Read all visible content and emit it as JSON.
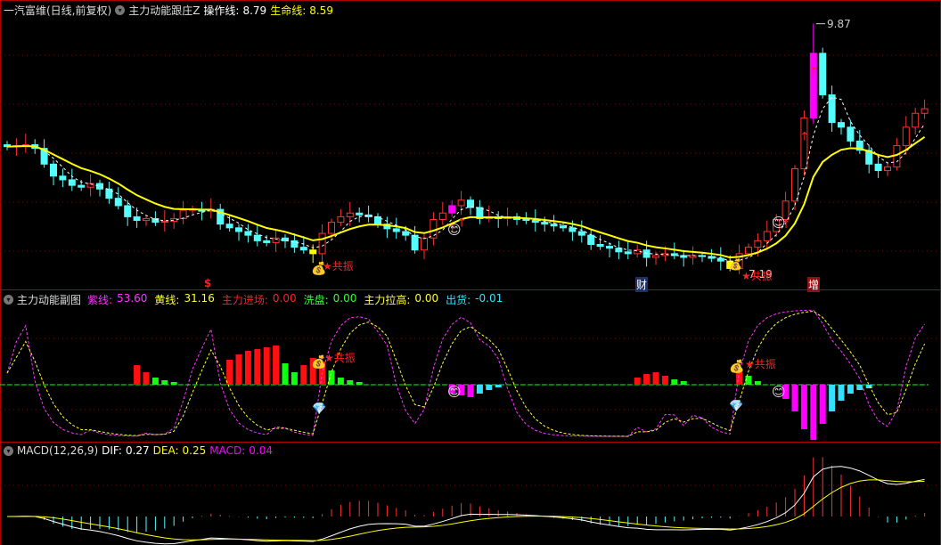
{
  "main_header": {
    "stock": "一汽富维(日线,前复权)",
    "indicator": "主力动能跟庄Z",
    "op_line_label": "操作线:",
    "op_line_value": "8.79",
    "life_line_label": "生命线:",
    "life_line_value": "8.59"
  },
  "sub_header": {
    "indicator": "主力动能副图",
    "items": [
      {
        "label": "紫线:",
        "value": "53.60",
        "color": "#ff33ff"
      },
      {
        "label": "黄线:",
        "value": "31.16",
        "color": "#ffff33"
      },
      {
        "label": "主力进场:",
        "value": "0.00",
        "color": "#ff2020"
      },
      {
        "label": "洗盘:",
        "value": "0.00",
        "color": "#33ff33"
      },
      {
        "label": "主力拉高:",
        "value": "0.00",
        "color": "#ffff33"
      },
      {
        "label": "出货:",
        "value": "-0.01",
        "color": "#33e0ff"
      }
    ]
  },
  "macd_header": {
    "indicator": "MACD(12,26,9)",
    "dif_label": "DIF:",
    "dif_value": "0.27",
    "dea_label": "DEA:",
    "dea_value": "0.25",
    "macd_label": "MACD:",
    "macd_value": "0.04"
  },
  "annotations": {
    "high_price": "9.87",
    "low_price": "7.19",
    "resonance": "共振",
    "dollar": "$",
    "cai": "财",
    "zeng": "增"
  },
  "colors": {
    "up": "#ff3030",
    "down": "#54fcfc",
    "life_line": "#ffff00",
    "op_line": "#ffffff",
    "grid": "#800000"
  },
  "chart_data": {
    "type": "candlestick",
    "title": "一汽富维(日线,前复权)",
    "ylim": [
      7.0,
      10.05
    ],
    "high_mark": 9.87,
    "low_mark": 7.19,
    "closes": [
      8.54,
      8.55,
      8.56,
      8.52,
      8.35,
      8.22,
      8.18,
      8.12,
      8.1,
      8.14,
      8.08,
      7.98,
      7.9,
      7.78,
      7.74,
      7.76,
      7.72,
      7.73,
      7.76,
      7.85,
      7.86,
      7.84,
      7.86,
      7.7,
      7.66,
      7.62,
      7.58,
      7.52,
      7.5,
      7.55,
      7.52,
      7.45,
      7.42,
      7.38,
      7.6,
      7.72,
      7.78,
      7.82,
      7.8,
      7.78,
      7.7,
      7.65,
      7.62,
      7.58,
      7.42,
      7.55,
      7.75,
      7.82,
      7.9,
      7.96,
      7.88,
      7.76,
      7.78,
      7.76,
      7.78,
      7.75,
      7.74,
      7.72,
      7.7,
      7.68,
      7.66,
      7.62,
      7.58,
      7.48,
      7.46,
      7.44,
      7.4,
      7.38,
      7.42,
      7.34,
      7.36,
      7.38,
      7.36,
      7.34,
      7.36,
      7.35,
      7.33,
      7.3,
      7.22,
      7.38,
      7.45,
      7.52,
      7.62,
      7.75,
      7.95,
      8.3,
      8.85,
      9.55,
      9.1,
      8.8,
      8.75,
      8.6,
      8.5,
      8.35,
      8.28,
      8.32,
      8.55,
      8.75,
      8.9,
      8.95
    ],
    "special_bars": {
      "magenta": [
        48,
        87
      ],
      "yellow": [
        33,
        78
      ]
    },
    "sub_histogram": {
      "red": {
        "14": 22,
        "15": 14,
        "24": 28,
        "25": 34,
        "26": 38,
        "27": 40,
        "28": 42,
        "29": 44,
        "32": 22,
        "33": 30,
        "34": 26,
        "68": 8,
        "69": 12,
        "70": 14,
        "71": 10,
        "79": 14
      },
      "green": {
        "16": 8,
        "17": 5,
        "18": 3,
        "30": 24,
        "31": 14,
        "35": 16,
        "36": 8,
        "37": 5,
        "38": 3,
        "72": 6,
        "73": 4,
        "80": 10,
        "81": 4
      },
      "magenta": {
        "48": -10,
        "49": -12,
        "50": -14,
        "84": -16,
        "85": -30,
        "86": -50,
        "87": -62,
        "88": -44
      },
      "cyan": {
        "51": -10,
        "52": -6,
        "53": -3,
        "89": -30,
        "90": -18,
        "91": -10,
        "92": -6,
        "93": -4
      }
    }
  }
}
